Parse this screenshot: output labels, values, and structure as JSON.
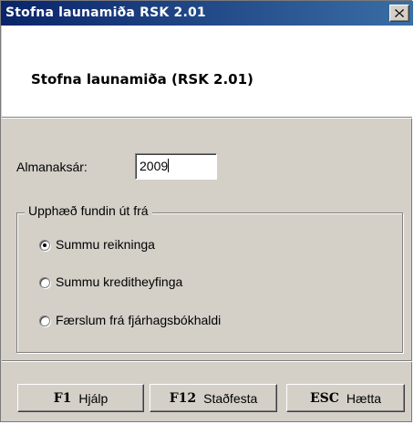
{
  "window": {
    "title": "Stofna launamiða RSK 2.01",
    "close_icon": "close-x-icon"
  },
  "header": {
    "heading": "Stofna launamiða (RSK 2.01)"
  },
  "form": {
    "year_label": "Almanaksár:",
    "year_value": "2009"
  },
  "group": {
    "legend": "Upphæð fundin út frá",
    "options": [
      {
        "label": "Summu reikninga",
        "selected": true
      },
      {
        "label": "Summu kreditheyfinga",
        "selected": false
      },
      {
        "label": "Færslum frá fjárhagsbókhaldi",
        "selected": false
      }
    ]
  },
  "buttons": {
    "help": {
      "key": "F1",
      "label": "Hjálp"
    },
    "confirm": {
      "key": "F12",
      "label": "Staðfesta"
    },
    "cancel": {
      "key": "ESC",
      "label": "Hætta"
    }
  },
  "colors": {
    "titlebar": "#0a246a",
    "face": "#d4d0c8"
  }
}
